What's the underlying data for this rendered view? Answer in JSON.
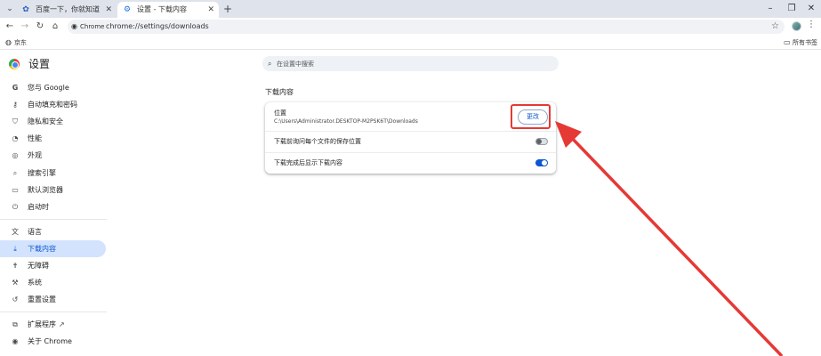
{
  "browser": {
    "tabs": [
      {
        "title": "百度一下，你就知道",
        "active": false
      },
      {
        "title": "设置 - 下载内容",
        "active": true
      }
    ],
    "site_chip": "Chrome",
    "url": "chrome://settings/downloads",
    "bookmarks": [
      {
        "label": "京东"
      }
    ],
    "all_bookmarks": "所有书签"
  },
  "settings": {
    "title": "设置",
    "search_placeholder": "在设置中搜索",
    "sidebar": [
      {
        "label": "您与 Google",
        "icon": "google-icon"
      },
      {
        "label": "自动填充和密码",
        "icon": "key-icon"
      },
      {
        "label": "隐私和安全",
        "icon": "shield-icon"
      },
      {
        "label": "性能",
        "icon": "speedometer-icon"
      },
      {
        "label": "外观",
        "icon": "palette-icon"
      },
      {
        "label": "搜索引擎",
        "icon": "search-icon"
      },
      {
        "label": "默认浏览器",
        "icon": "browser-icon"
      },
      {
        "label": "启动时",
        "icon": "power-icon"
      },
      {
        "label": "语言",
        "icon": "translate-icon"
      },
      {
        "label": "下载内容",
        "icon": "download-icon",
        "selected": true
      },
      {
        "label": "无障碍",
        "icon": "accessibility-icon"
      },
      {
        "label": "系统",
        "icon": "wrench-icon"
      },
      {
        "label": "重置设置",
        "icon": "reset-icon"
      },
      {
        "label": "扩展程序",
        "icon": "puzzle-icon"
      },
      {
        "label": "关于 Chrome",
        "icon": "chrome-icon"
      }
    ],
    "section_title": "下载内容",
    "location_label": "位置",
    "location_path": "C:\\Users\\Administrator.DESKTOP-M2PSK6T\\Downloads",
    "change_button": "更改",
    "ask_where_label": "下载前询问每个文件的保存位置",
    "ask_where_enabled": false,
    "show_when_done_label": "下载完成后显示下载内容",
    "show_when_done_enabled": true
  },
  "colors": {
    "accent": "#0b57d0",
    "selected_bg": "#d3e3fd",
    "annotation": "#e53935"
  }
}
